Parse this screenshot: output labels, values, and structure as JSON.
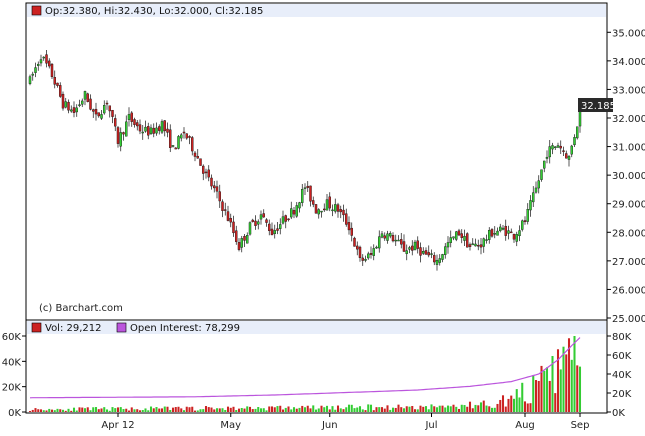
{
  "price_panel": {
    "legend_ohlc": "Op:32.380, Hi:32.430, Lo:32.000, Cl:32.185",
    "last_price_tag": "32.185",
    "watermark": "(c) Barchart.com",
    "y_ticks": [
      "35.000",
      "34.000",
      "33.000",
      "32.000",
      "31.000",
      "30.000",
      "29.000",
      "28.000",
      "27.000",
      "26.000",
      "25.000"
    ]
  },
  "volume_panel": {
    "legend_vol": "Vol: 29,212",
    "legend_oi": "Open Interest: 78,299",
    "left_ticks": [
      "60K",
      "40K",
      "20K",
      "0K"
    ],
    "right_ticks": [
      "80K",
      "60K",
      "40K",
      "20K",
      "0K"
    ]
  },
  "x_ticks": [
    "Apr 12",
    "May",
    "Jun",
    "Jul",
    "Aug",
    "Sep"
  ],
  "colors": {
    "up": "#33cc33",
    "down": "#cc2222",
    "oi_line": "#bb55dd",
    "frame": "#000000",
    "header_bg": "#e8eefa"
  },
  "chart_data": {
    "type": "candlestick",
    "price_ylim": [
      25.0,
      35.5
    ],
    "volume_ylim": [
      0,
      60000
    ],
    "open_interest_ylim": [
      0,
      80000
    ],
    "price_anchors": [
      [
        0,
        33.3
      ],
      [
        4,
        34.2
      ],
      [
        8,
        33.5
      ],
      [
        12,
        32.5
      ],
      [
        16,
        32.2
      ],
      [
        20,
        32.8
      ],
      [
        24,
        32.0
      ],
      [
        28,
        32.6
      ],
      [
        32,
        31.2
      ],
      [
        36,
        32.0
      ],
      [
        40,
        31.6
      ],
      [
        44,
        31.5
      ],
      [
        48,
        31.8
      ],
      [
        52,
        30.9
      ],
      [
        56,
        31.5
      ],
      [
        60,
        30.8
      ],
      [
        64,
        30.0
      ],
      [
        68,
        29.3
      ],
      [
        72,
        28.5
      ],
      [
        76,
        27.5
      ],
      [
        80,
        28.2
      ],
      [
        84,
        28.6
      ],
      [
        88,
        28.0
      ],
      [
        92,
        28.4
      ],
      [
        96,
        28.8
      ],
      [
        100,
        29.6
      ],
      [
        104,
        28.8
      ],
      [
        108,
        29.0
      ],
      [
        112,
        28.8
      ],
      [
        116,
        28.2
      ],
      [
        120,
        27.0
      ],
      [
        124,
        27.2
      ],
      [
        128,
        28.0
      ],
      [
        132,
        27.8
      ],
      [
        136,
        27.4
      ],
      [
        140,
        27.5
      ],
      [
        144,
        27.2
      ],
      [
        148,
        27.0
      ],
      [
        152,
        27.6
      ],
      [
        156,
        28.0
      ],
      [
        160,
        27.5
      ],
      [
        164,
        27.6
      ],
      [
        168,
        28.0
      ],
      [
        172,
        28.1
      ],
      [
        176,
        27.9
      ],
      [
        180,
        28.4
      ],
      [
        184,
        29.5
      ],
      [
        188,
        30.8
      ],
      [
        192,
        31.1
      ],
      [
        196,
        30.6
      ],
      [
        200,
        32.2
      ]
    ],
    "volume_anchors": [
      [
        0,
        2000
      ],
      [
        40,
        2500
      ],
      [
        80,
        3000
      ],
      [
        120,
        3500
      ],
      [
        150,
        4000
      ],
      [
        160,
        5000
      ],
      [
        170,
        7000
      ],
      [
        175,
        10000
      ],
      [
        180,
        15000
      ],
      [
        185,
        20000
      ],
      [
        190,
        28000
      ],
      [
        195,
        38000
      ],
      [
        200,
        50000
      ]
    ],
    "open_interest_anchors": [
      [
        0,
        15000
      ],
      [
        30,
        15500
      ],
      [
        60,
        16000
      ],
      [
        90,
        18000
      ],
      [
        120,
        21000
      ],
      [
        140,
        23000
      ],
      [
        160,
        27000
      ],
      [
        175,
        32000
      ],
      [
        185,
        40000
      ],
      [
        192,
        55000
      ],
      [
        197,
        70000
      ],
      [
        200,
        78299
      ]
    ],
    "bar_count": 201,
    "x_tick_bar_index": [
      32,
      73,
      109,
      146,
      180,
      200
    ]
  }
}
